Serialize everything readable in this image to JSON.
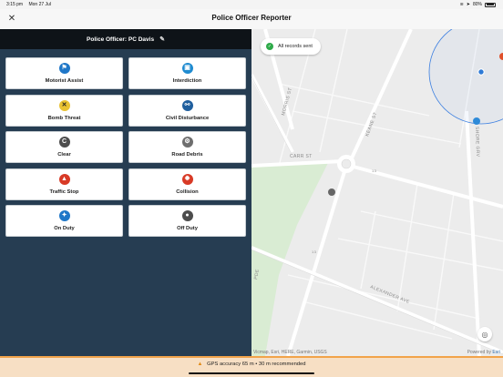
{
  "status_bar": {
    "time": "3:15 pm",
    "date": "Mon 27 Jul",
    "battery": "80%"
  },
  "nav": {
    "title": "Police Officer Reporter",
    "close_icon": "close-icon"
  },
  "officer": {
    "label": "Police Officer: PC Davis",
    "edit_icon": "pencil-icon"
  },
  "incidents": [
    {
      "label": "Motorist Assist",
      "icon": "motorist-assist-icon",
      "color": "#1f77c8",
      "glyph": "⚑"
    },
    {
      "label": "Interdiction",
      "icon": "interdiction-icon",
      "color": "#1f8bd0",
      "glyph": "▣"
    },
    {
      "label": "Bomb Threat",
      "icon": "bomb-threat-icon",
      "color": "#e9c233",
      "glyph": "✕"
    },
    {
      "label": "Civil Disturbance",
      "icon": "civil-disturbance-icon",
      "color": "#1f5f9e",
      "glyph": "⚯"
    },
    {
      "label": "Clear",
      "icon": "clear-icon",
      "color": "#4d4d4d",
      "glyph": "C"
    },
    {
      "label": "Road Debris",
      "icon": "road-debris-icon",
      "color": "#6e6e6e",
      "glyph": "⚙"
    },
    {
      "label": "Traffic Stop",
      "icon": "traffic-stop-icon",
      "color": "#d83a26",
      "glyph": "▲"
    },
    {
      "label": "Collision",
      "icon": "collision-icon",
      "color": "#d83a26",
      "glyph": "✹"
    },
    {
      "label": "On Duty",
      "icon": "on-duty-icon",
      "color": "#1f77c8",
      "glyph": "✦"
    },
    {
      "label": "Off Duty",
      "icon": "off-duty-icon",
      "color": "#4d4d4d",
      "glyph": "●"
    }
  ],
  "map": {
    "toast": "All records sent",
    "streets": [
      "MORRIS ST",
      "KEANE ST",
      "CARR ST",
      "SHORE GRV",
      "ALEXANDER AVE",
      "13",
      "13",
      "PDE"
    ],
    "attribution": "Vicmap, Esri, HERE, Garmin, USGS",
    "powered_by": "Powered by",
    "powered_brand": "Esri"
  },
  "gps": {
    "message": "GPS accuracy 65 m  •  30 m recommended"
  }
}
